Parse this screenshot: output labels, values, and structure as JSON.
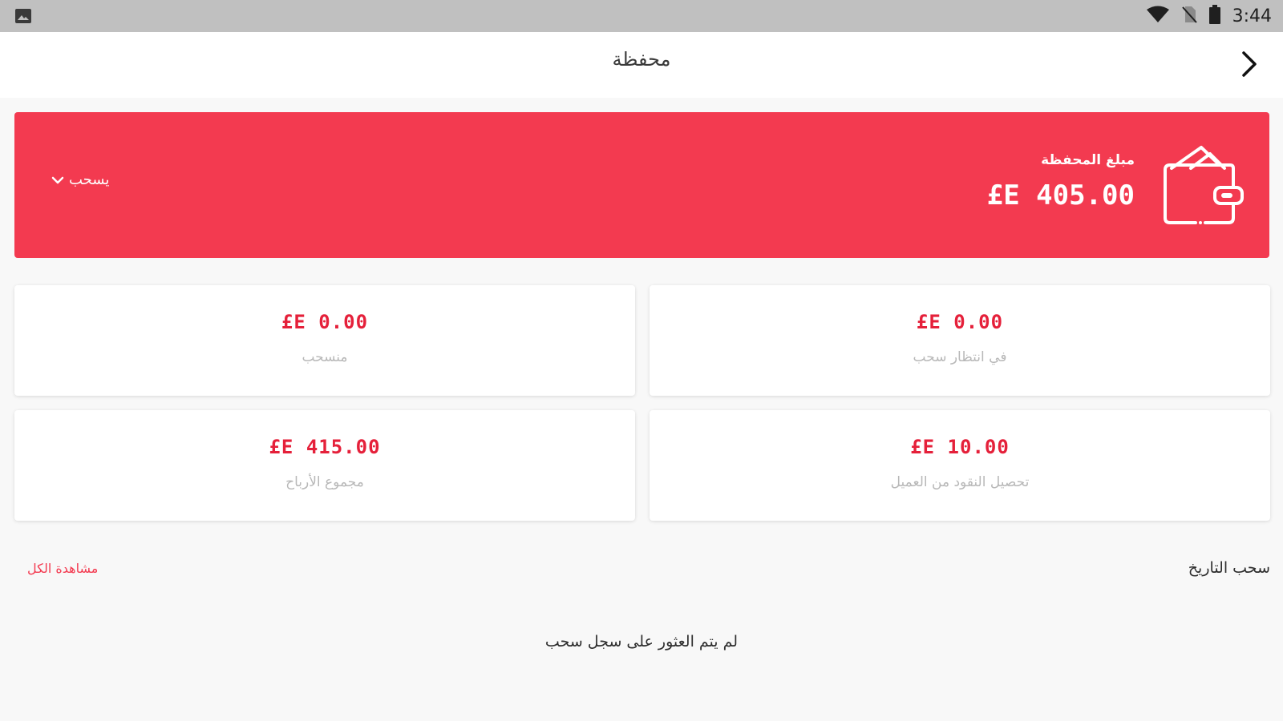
{
  "status_bar": {
    "time": "3:44",
    "icons": [
      "image-notification-icon",
      "wifi-icon",
      "no-sim-icon",
      "battery-icon"
    ]
  },
  "app_bar": {
    "title": "محفظة",
    "back_icon": "chevron-right-icon"
  },
  "wallet": {
    "balance_label": "مبلغ المحفظة",
    "balance_value": "£E 405.00",
    "withdraw_label": "يسحب",
    "icon": "wallet-icon",
    "accent_color": "#f33a50"
  },
  "stats": [
    {
      "amount": "£E 0.00",
      "label": "في انتظار سحب"
    },
    {
      "amount": "£E 0.00",
      "label": "منسحب"
    },
    {
      "amount": "£E 10.00",
      "label": "تحصيل النقود من العميل"
    },
    {
      "amount": "£E 415.00",
      "label": "مجموع الأرباح"
    }
  ],
  "history": {
    "title": "سحب التاريخ",
    "view_all": "مشاهدة الكل",
    "empty_message": "لم يتم العثور على سجل سحب"
  }
}
